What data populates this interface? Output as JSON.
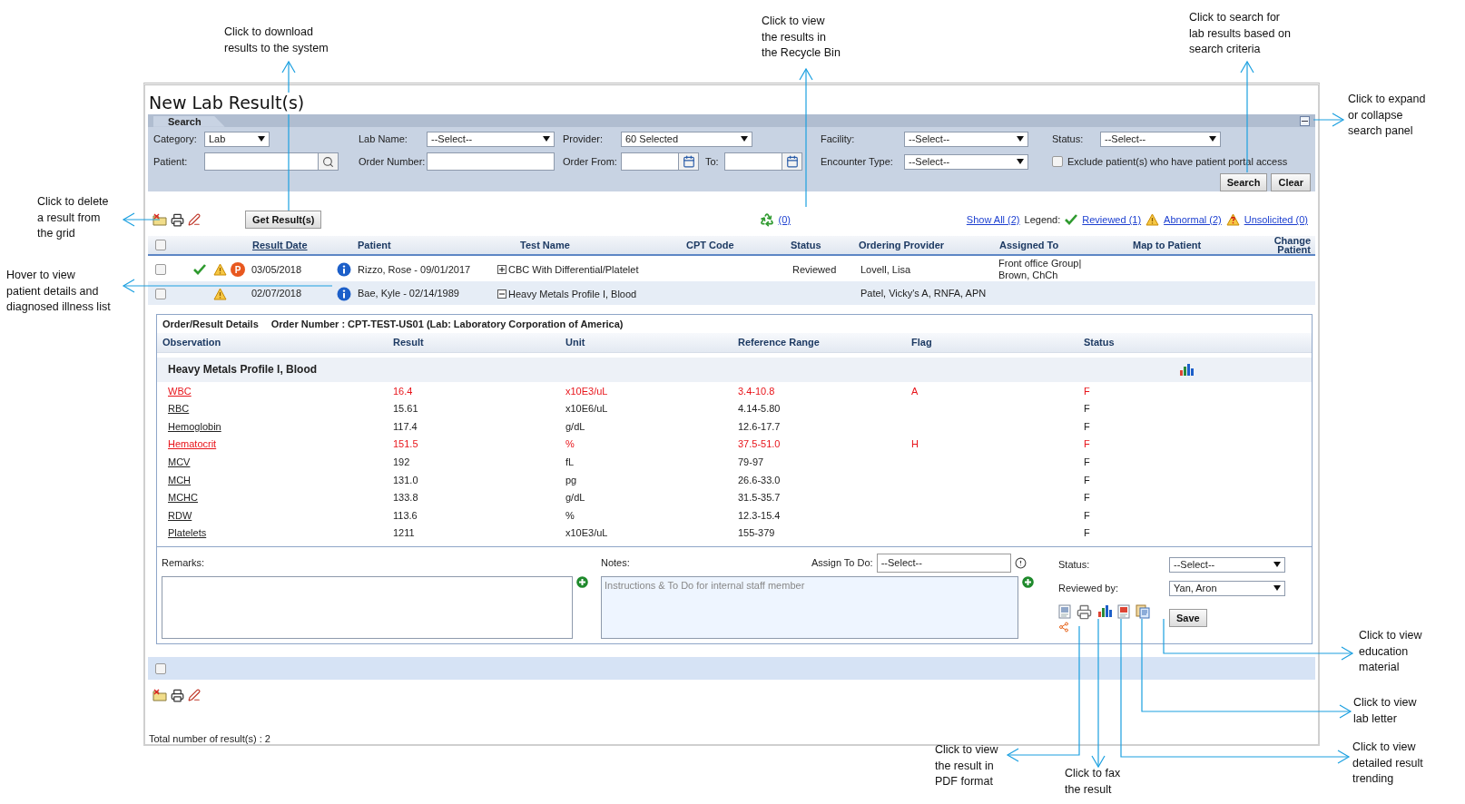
{
  "page_title": "New Lab Result(s)",
  "search_panel": {
    "tab": "Search",
    "expanded": true,
    "rows": [
      [
        {
          "kind": "select",
          "label": "Category:",
          "value": "Lab"
        },
        {
          "kind": "select",
          "label": "Lab Name:",
          "value": "--Select--"
        },
        {
          "kind": "select",
          "label": "Provider:",
          "value": "60 Selected"
        },
        {
          "kind": "select",
          "label": "Facility:",
          "value": "--Select--"
        },
        {
          "kind": "select",
          "label": "Status:",
          "value": "--Select--"
        }
      ],
      [
        {
          "kind": "search",
          "label": "Patient:"
        },
        {
          "kind": "text",
          "label": "Order Number:"
        },
        {
          "kind": "daterange",
          "label": "Order From:",
          "to_label": "To:"
        },
        {
          "kind": "select",
          "label": "Encounter Type:",
          "value": "--Select--"
        },
        {
          "kind": "checkbox",
          "label": "Exclude patient(s) who have patient portal access",
          "checked": false
        }
      ]
    ],
    "buttons": [
      "Search",
      "Clear"
    ]
  },
  "toolbar": {
    "get_results": "Get Result(s)",
    "recycle_count": "(0)",
    "show_all": "Show All (2)",
    "legend_label": "Legend:",
    "legend": [
      {
        "kind": "reviewed",
        "label": "Reviewed (1)"
      },
      {
        "kind": "abnormal",
        "label": "Abnormal (2)"
      },
      {
        "kind": "unsolicited",
        "label": "Unsolicited (0)"
      }
    ]
  },
  "grid": {
    "header_checked": false,
    "columns": [
      "Result Date",
      "Patient",
      "Test Name",
      "CPT Code",
      "Status",
      "Ordering Provider",
      "Assigned To",
      "Map to Patient",
      "Change Patient"
    ],
    "rows": [
      {
        "checked": false,
        "reviewed": true,
        "abnormal": true,
        "badge": "P",
        "result_date": "03/05/2018",
        "patient": "Rizzo, Rose - 09/01/2017",
        "test_name": "CBC With Differential/Platelet",
        "expanded": false,
        "status": "Reviewed",
        "provider": "Lovell, Lisa",
        "assigned_to": [
          "Front office Group|",
          "Brown, ChCh"
        ]
      },
      {
        "checked": false,
        "reviewed": false,
        "abnormal": true,
        "result_date": "02/07/2018",
        "patient": "Bae, Kyle - 02/14/1989",
        "test_name": "Heavy Metals Profile I, Blood",
        "expanded": true,
        "provider": "Patel, Vicky's A, RNFA, APN"
      }
    ]
  },
  "details": {
    "title": "Order/Result Details",
    "order": "Order Number : CPT-TEST-US01 (Lab: Laboratory Corporation of America)",
    "columns": [
      "Observation",
      "Result",
      "Unit",
      "Reference Range",
      "Flag",
      "Status"
    ],
    "group": "Heavy Metals Profile I, Blood",
    "rows": [
      {
        "abnormal": true,
        "observation": "WBC",
        "result": "16.4",
        "unit": "x10E3/uL",
        "range": "3.4-10.8",
        "flag": "A",
        "status": "F"
      },
      {
        "abnormal": false,
        "observation": "RBC",
        "result": "15.61",
        "unit": "x10E6/uL",
        "range": "4.14-5.80",
        "status": "F"
      },
      {
        "abnormal": false,
        "observation": "Hemoglobin",
        "result": "117.4",
        "unit": "g/dL",
        "range": "12.6-17.7",
        "status": "F"
      },
      {
        "abnormal": true,
        "observation": "Hematocrit",
        "result": "151.5",
        "unit": "%",
        "range": "37.5-51.0",
        "flag": "H",
        "status": "F"
      },
      {
        "abnormal": false,
        "observation": "MCV",
        "result": "192",
        "unit": "fL",
        "range": "79-97",
        "status": "F"
      },
      {
        "abnormal": false,
        "observation": "MCH",
        "result": "131.0",
        "unit": "pg",
        "range": "26.6-33.0",
        "status": "F"
      },
      {
        "abnormal": false,
        "observation": "MCHC",
        "result": "133.8",
        "unit": "g/dL",
        "range": "31.5-35.7",
        "status": "F"
      },
      {
        "abnormal": false,
        "observation": "RDW",
        "result": "113.6",
        "unit": "%",
        "range": "12.3-15.4",
        "status": "F"
      },
      {
        "abnormal": false,
        "observation": "Platelets",
        "result": "1211",
        "unit": "x10E3/uL",
        "range": "155-379",
        "status": "F"
      }
    ],
    "remarks_label": "Remarks:",
    "notes_label": "Notes:",
    "notes_placeholder": "Instructions & To Do for internal staff member",
    "assign_label": "Assign To Do:",
    "assign_value": "--Select--",
    "status_label": "Status:",
    "status_value": "--Select--",
    "reviewed_label": "Reviewed by:",
    "reviewed_value": "Yan, Aron",
    "save": "Save"
  },
  "footer": {
    "checked": false,
    "total": "Total number of result(s) : 2"
  },
  "annotations": [
    "Click to download\nresults to the system",
    "Click to view\nthe results in\nthe Recycle Bin",
    "Click to search for\nlab results based on\nsearch criteria",
    "Click to expand\nor collapse\nsearch panel",
    "Click to delete\na result from\nthe grid",
    "Hover to view\npatient details and\ndiagnosed illness list",
    "Click to view\neducation\nmaterial",
    "Click to view\nlab letter",
    "Click to view\nthe result in\nPDF format",
    "Click to view\ndetailed result\ntrending",
    "Click to fax\nthe result"
  ]
}
